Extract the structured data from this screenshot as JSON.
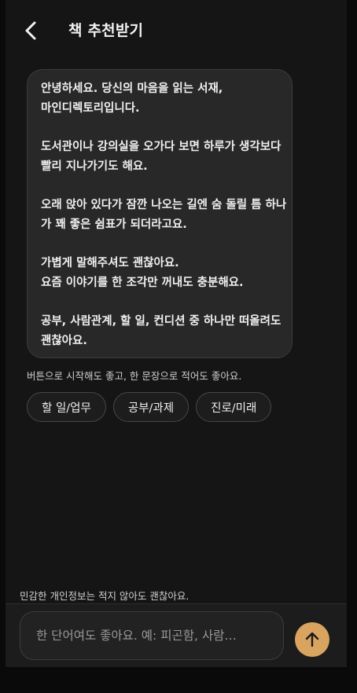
{
  "header": {
    "title": "책 추천받기",
    "back_icon": "chevron-left-icon"
  },
  "bubble": {
    "lines": [
      "안녕하세요. 당신의 마음을 읽는 서재,",
      "마인디렉토리입니다.",
      "",
      "도서관이나 강의실을 오가다 보면 하루가 생각보다",
      "빨리 지나가기도 해요.",
      "",
      "오래 앉아 있다가 잠깐 나오는 길엔 숨 돌릴 틈 하나",
      "가 꽤 좋은 쉼표가 되더라고요.",
      "",
      "가볍게 말해주셔도 괜찮아요.",
      "요즘 이야기를 한 조각만 꺼내도 충분해요.",
      "",
      "공부, 사람관계, 할 일, 컨디션 중 하나만 떠올려도",
      "괜찮아요."
    ]
  },
  "hint": "버튼으로 시작해도 좋고, 한 문장으로 적어도 좋아요.",
  "chips": [
    {
      "label": "할 일/업무"
    },
    {
      "label": "공부/과제"
    },
    {
      "label": "진로/미래"
    }
  ],
  "privacy_note": "민감한 개인정보는 적지 않아도 괜찮아요.",
  "input": {
    "placeholder": "한 단어여도 좋아요. 예: 피곤함, 사람…",
    "value": ""
  },
  "send_button": {
    "icon": "arrow-up-icon",
    "color": "#d9a460"
  },
  "colors": {
    "background": "#0a0a0a",
    "panel": "#151515",
    "bubble": "#282828",
    "accent": "#d9a460"
  }
}
